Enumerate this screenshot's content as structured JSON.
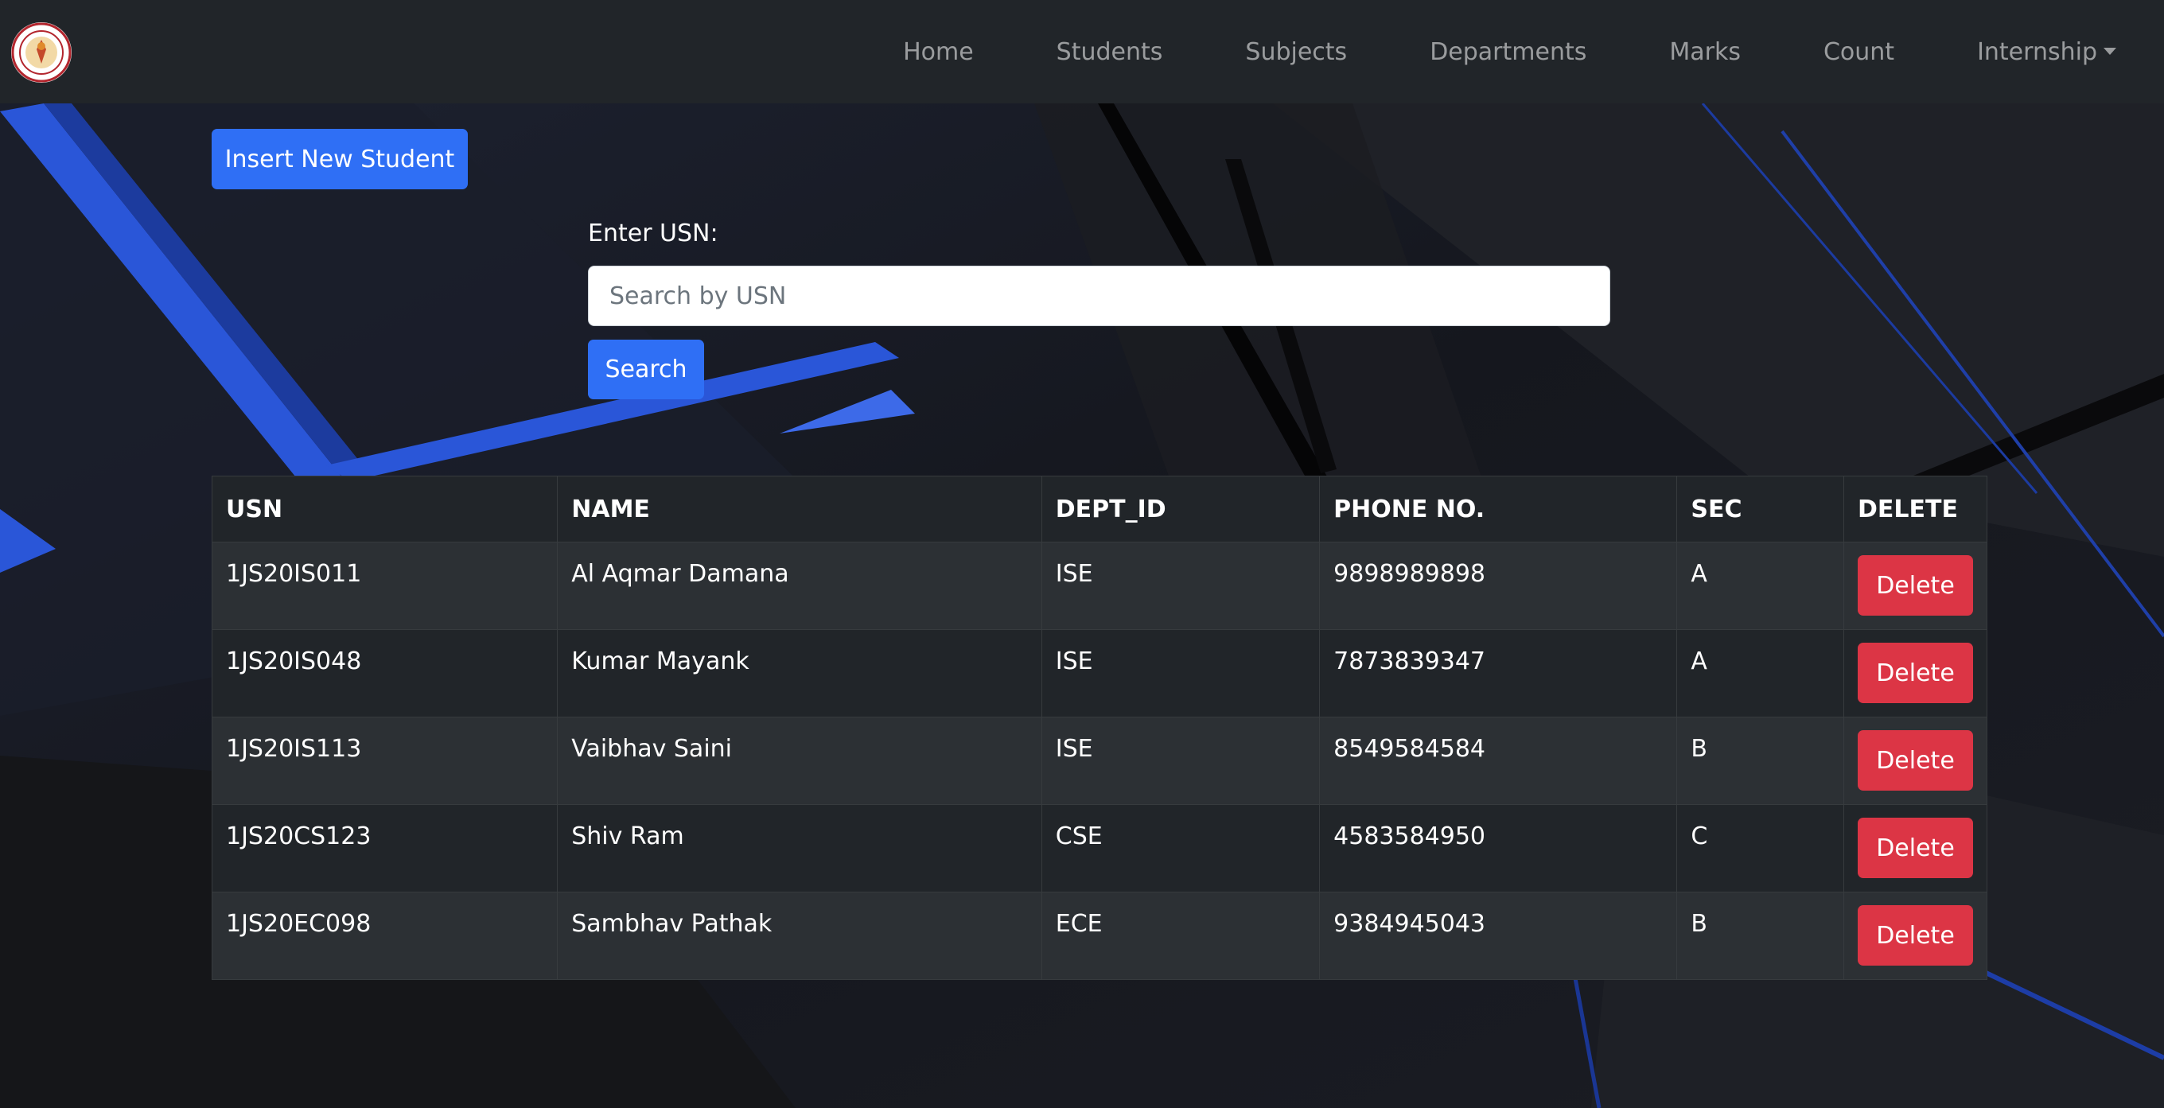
{
  "navbar": {
    "logo_icon": "college-seal-logo",
    "links": [
      {
        "label": "Home"
      },
      {
        "label": "Students"
      },
      {
        "label": "Subjects"
      },
      {
        "label": "Departments"
      },
      {
        "label": "Marks"
      },
      {
        "label": "Count"
      },
      {
        "label": "Internship",
        "dropdown": true
      }
    ]
  },
  "actions": {
    "insert_label": "Insert New Student"
  },
  "search": {
    "label": "Enter USN:",
    "placeholder": "Search by USN",
    "value": "",
    "button_label": "Search"
  },
  "table": {
    "headers": {
      "usn": "USN",
      "name": "NAME",
      "dept": "DEPT_ID",
      "phone": "PHONE NO.",
      "sec": "SEC",
      "delete": "DELETE"
    },
    "rows": [
      {
        "usn": "1JS20IS011",
        "name": "Al Aqmar Damana",
        "dept": "ISE",
        "phone": "9898989898",
        "sec": "A",
        "delete_label": "Delete"
      },
      {
        "usn": "1JS20IS048",
        "name": "Kumar Mayank",
        "dept": "ISE",
        "phone": "7873839347",
        "sec": "A",
        "delete_label": "Delete"
      },
      {
        "usn": "1JS20IS113",
        "name": "Vaibhav Saini",
        "dept": "ISE",
        "phone": "8549584584",
        "sec": "B",
        "delete_label": "Delete"
      },
      {
        "usn": "1JS20CS123",
        "name": "Shiv Ram",
        "dept": "CSE",
        "phone": "4583584950",
        "sec": "C",
        "delete_label": "Delete"
      },
      {
        "usn": "1JS20EC098",
        "name": "Sambhav Pathak",
        "dept": "ECE",
        "phone": "9384945043",
        "sec": "B",
        "delete_label": "Delete"
      }
    ]
  },
  "colors": {
    "navbar_bg": "#212529",
    "primary": "#2f6ff5",
    "danger": "#dc3545",
    "page_bg": "#17181d",
    "accent_blue": "#2a56d8"
  }
}
